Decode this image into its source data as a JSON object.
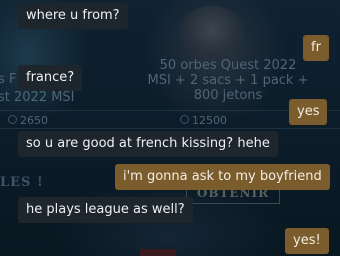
{
  "background": {
    "left_fragment_1": "s F",
    "left_fragment_2": "st 2022 MSI",
    "left_price": "2650",
    "offer_title_line1": "50 orbes Quest 2022",
    "offer_title_line2": "MSI + 2 sacs + 1 pack +",
    "offer_title_line3": "800 jetons",
    "offer_price": "12500",
    "section_fragment": "LES !",
    "buy_button_label": "OBTENIR"
  },
  "chat": {
    "messages": [
      {
        "sender": "them",
        "text": "where u from?"
      },
      {
        "sender": "me",
        "text": "fr"
      },
      {
        "sender": "them",
        "text": "france?"
      },
      {
        "sender": "me",
        "text": "yes"
      },
      {
        "sender": "them",
        "text": "so u are good at french kissing? hehe"
      },
      {
        "sender": "me",
        "text": "i'm gonna ask to my boyfriend"
      },
      {
        "sender": "them",
        "text": "he plays league as well?"
      },
      {
        "sender": "me",
        "text": "yes!"
      }
    ]
  },
  "colors": {
    "incoming_bubble": "#1d252d",
    "outgoing_bubble": "#7b5c2c",
    "background": "#0b1a26"
  }
}
